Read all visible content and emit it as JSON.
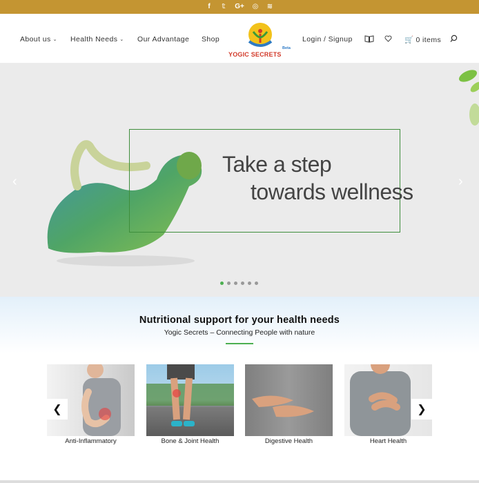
{
  "social": {
    "facebook": "f",
    "twitter": "𝕥",
    "google_plus": "G+",
    "instagram": "◎",
    "rss": "≋"
  },
  "nav": {
    "about": "About us",
    "health_needs": "Health Needs",
    "advantage": "Our Advantage",
    "shop": "Shop",
    "login": "Login / Signup",
    "cart": "0 items"
  },
  "logo": {
    "name": "YOGIC SECRETS",
    "beta": "Beta"
  },
  "hero": {
    "line1": "Take a step",
    "line2": "towards wellness",
    "slides_total": 6,
    "slide_active": 1
  },
  "section": {
    "title": "Nutritional support for your health needs",
    "subtitle": "Yogic Secrets – Connecting People with nature"
  },
  "cards": [
    {
      "label": "Anti-Inflammatory"
    },
    {
      "label": "Bone & Joint Health"
    },
    {
      "label": "Digestive Health"
    },
    {
      "label": "Heart Health"
    }
  ],
  "colors": {
    "topbar": "#c49532",
    "accent_green": "#4caf50",
    "logo_red": "#d23a2a"
  }
}
